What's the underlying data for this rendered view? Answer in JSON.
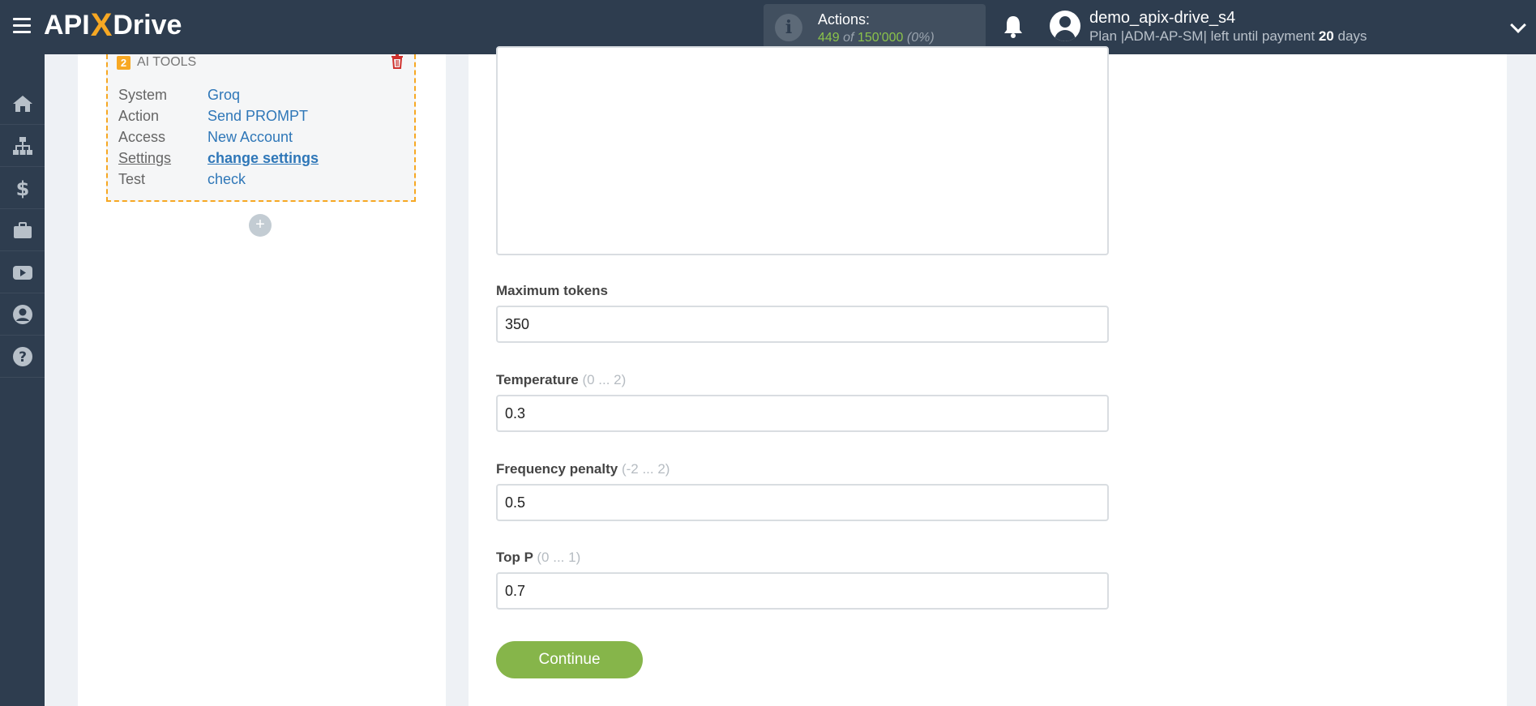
{
  "header": {
    "logo_left": "API",
    "logo_x": "X",
    "logo_right": "Drive",
    "actions_label": "Actions:",
    "actions_used": "449",
    "actions_of": "of",
    "actions_total": "150'000",
    "actions_percent": "(0%)",
    "username": "demo_apix-drive_s4",
    "plan_text": "Plan |ADM-AP-SM| left until payment",
    "plan_days": "20",
    "plan_days_suffix": "days"
  },
  "nav": {
    "icons": [
      "home-icon",
      "sitemap-icon",
      "dollar-icon",
      "briefcase-icon",
      "youtube-icon",
      "user-icon",
      "help-icon"
    ]
  },
  "card": {
    "number": "2",
    "title": "AI TOOLS",
    "rows": [
      {
        "key": "System",
        "value": "Groq"
      },
      {
        "key": "Action",
        "value": "Send PROMPT"
      },
      {
        "key": "Access",
        "value": "New Account"
      },
      {
        "key": "Settings",
        "value": "change settings"
      },
      {
        "key": "Test",
        "value": "check"
      }
    ],
    "add_label": "+"
  },
  "form": {
    "max_tokens": {
      "label": "Maximum tokens",
      "hint": "",
      "value": "350"
    },
    "temperature": {
      "label": "Temperature",
      "hint": "(0 ... 2)",
      "value": "0.3"
    },
    "frequency_penalty": {
      "label": "Frequency penalty",
      "hint": "(-2 ... 2)",
      "value": "0.5"
    },
    "top_p": {
      "label": "Top P",
      "hint": "(0 ... 1)",
      "value": "0.7"
    },
    "continue_label": "Continue"
  },
  "colors": {
    "topbar": "#2e3d4f",
    "accent_orange": "#f7a823",
    "link_blue": "#2f77b8",
    "button_green": "#86b54a"
  }
}
